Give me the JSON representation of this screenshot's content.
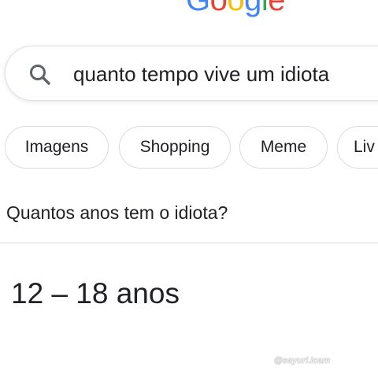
{
  "logo": {
    "text": "Google",
    "letters": [
      "G",
      "o",
      "o",
      "g",
      "l",
      "e"
    ],
    "colors": [
      "#4285f4",
      "#ea4335",
      "#fbbc05",
      "#4285f4",
      "#34a853",
      "#ea4335"
    ]
  },
  "search": {
    "icon": "search-icon",
    "query": "quanto tempo vive um idiota"
  },
  "chips": [
    {
      "label": "Imagens"
    },
    {
      "label": "Shopping"
    },
    {
      "label": "Meme"
    },
    {
      "label": "Liv"
    }
  ],
  "result": {
    "question": "Quantos anos tem o idiota?",
    "answer": "12 – 18 anos"
  },
  "watermark": "@sayuri.lcam"
}
